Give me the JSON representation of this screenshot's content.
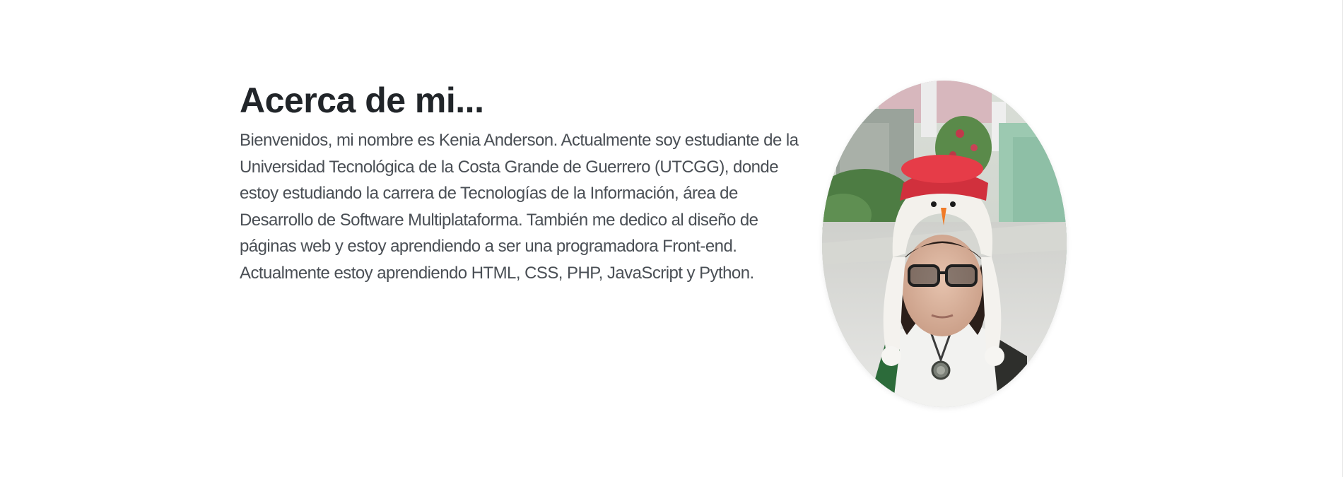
{
  "about": {
    "title": "Acerca de mi...",
    "description": "Bienvenidos, mi nombre es Kenia Anderson. Actualmente soy estudiante de la Universidad Tecnológica de la Costa Grande de Guerrero (UTCGG), donde estoy estudiando la carrera de Tecnologías de la Información, área de Desarrollo de Software Multiplataforma. También me dedico al diseño de páginas web y estoy aprendiendo a ser una programadora Front-end. Actualmente estoy aprendiendo HTML, CSS, PHP, JavaScript y Python."
  },
  "colors": {
    "heading": "#212529",
    "body_text": "#4a4f55",
    "background": "#ffffff"
  }
}
